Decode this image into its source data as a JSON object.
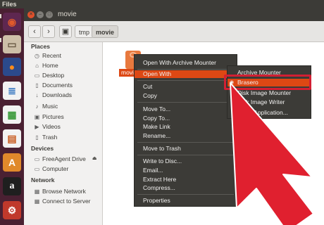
{
  "topbar": {
    "title": "Files"
  },
  "launcher": {
    "items": [
      {
        "icon": "ubuntu-dash-icon",
        "glyph": "◉",
        "color": "#e05a2b"
      },
      {
        "icon": "files-icon",
        "glyph": "▭",
        "color": "#b8a48c"
      },
      {
        "icon": "firefox-icon",
        "glyph": "●",
        "color": "#e66000"
      },
      {
        "icon": "libreoffice-writer-icon",
        "glyph": "≣",
        "color": "#2a6fbe"
      },
      {
        "icon": "libreoffice-calc-icon",
        "glyph": "▦",
        "color": "#3b9a3b"
      },
      {
        "icon": "libreoffice-impress-icon",
        "glyph": "▤",
        "color": "#c85a1e"
      },
      {
        "icon": "software-center-icon",
        "glyph": "A",
        "color": "#e0892b"
      },
      {
        "icon": "amazon-icon",
        "glyph": "a",
        "color": "#ffffff"
      },
      {
        "icon": "system-settings-icon",
        "glyph": "⚙",
        "color": "#c0392b"
      }
    ]
  },
  "window": {
    "title": "movie",
    "breadcrumbs": [
      "tmp",
      "movie"
    ]
  },
  "sidebar": {
    "places_header": "Places",
    "places": [
      {
        "label": "Recent",
        "icon": "clock-icon",
        "glyph": "◷"
      },
      {
        "label": "Home",
        "icon": "home-icon",
        "glyph": "⌂"
      },
      {
        "label": "Desktop",
        "icon": "desktop-icon",
        "glyph": "▭"
      },
      {
        "label": "Documents",
        "icon": "documents-icon",
        "glyph": "▯"
      },
      {
        "label": "Downloads",
        "icon": "downloads-icon",
        "glyph": "↓"
      },
      {
        "label": "Music",
        "icon": "music-icon",
        "glyph": "♪"
      },
      {
        "label": "Pictures",
        "icon": "pictures-icon",
        "glyph": "▣"
      },
      {
        "label": "Videos",
        "icon": "videos-icon",
        "glyph": "▶"
      },
      {
        "label": "Trash",
        "icon": "trash-icon",
        "glyph": "▯"
      }
    ],
    "devices_header": "Devices",
    "devices": [
      {
        "label": "FreeAgent Drive",
        "icon": "drive-icon",
        "glyph": "▭"
      },
      {
        "label": "Computer",
        "icon": "computer-icon",
        "glyph": "▭"
      }
    ],
    "network_header": "Network",
    "network": [
      {
        "label": "Browse Network",
        "icon": "network-icon",
        "glyph": "▦"
      },
      {
        "label": "Connect to Server",
        "icon": "server-icon",
        "glyph": "▦"
      }
    ]
  },
  "file": {
    "label": "movi",
    "icon": "archive-file-icon"
  },
  "context_menu": {
    "items": [
      "Open With Archive Mounter",
      "Open With",
      "Cut",
      "Copy",
      "Move To...",
      "Copy To...",
      "Make Link",
      "Rename...",
      "Move to Trash",
      "Write to Disc...",
      "Email...",
      "Extract Here",
      "Compress...",
      "Properties"
    ],
    "highlighted": "Open With"
  },
  "submenu": {
    "items": [
      "Archive Mounter",
      "Brasero",
      "Disk Image Mounter",
      "Disk Image Writer",
      "Other Application..."
    ],
    "highlighted": "Brasero"
  },
  "colors": {
    "accent": "#dd4814",
    "arrow": "#e0202f",
    "highlight_box": "#d21f33"
  }
}
